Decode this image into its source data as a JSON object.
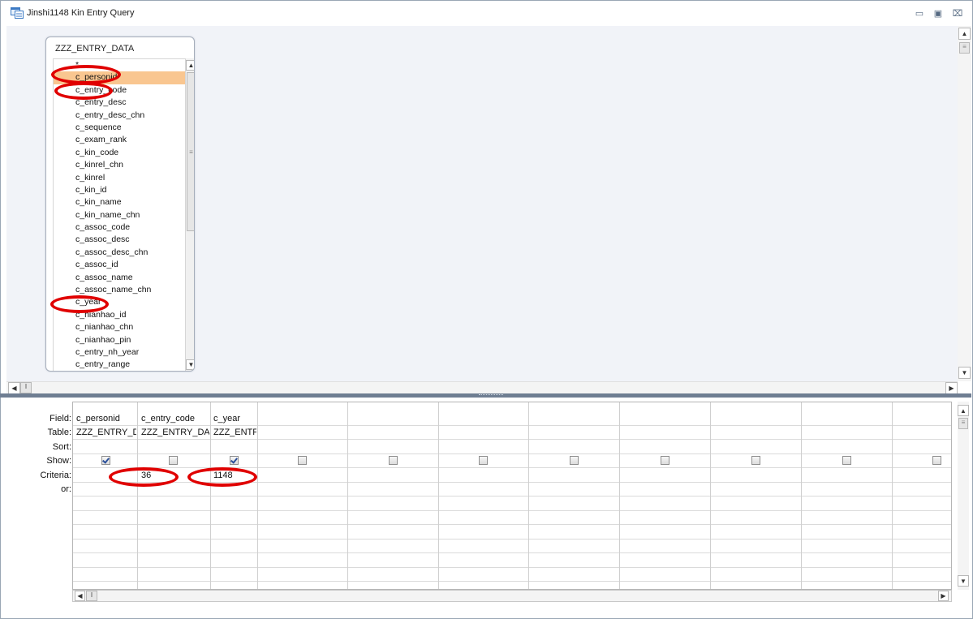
{
  "window": {
    "title": "Jinshi1148 Kin Entry Query",
    "minimize_icon": "minimize-icon",
    "restore_icon": "restore-icon",
    "close_icon": "close-icon"
  },
  "table_box": {
    "title": "ZZZ_ENTRY_DATA",
    "fields": [
      "*",
      "c_personid",
      "c_entry_code",
      "c_entry_desc",
      "c_entry_desc_chn",
      "c_sequence",
      "c_exam_rank",
      "c_kin_code",
      "c_kinrel_chn",
      "c_kinrel",
      "c_kin_id",
      "c_kin_name",
      "c_kin_name_chn",
      "c_assoc_code",
      "c_assoc_desc",
      "c_assoc_desc_chn",
      "c_assoc_id",
      "c_assoc_name",
      "c_assoc_name_chn",
      "c_year",
      "c_nianhao_id",
      "c_nianhao_chn",
      "c_nianhao_pin",
      "c_entry_nh_year",
      "c_entry_range"
    ],
    "selected_field": "c_personid"
  },
  "grid": {
    "row_labels": {
      "field": "Field:",
      "table": "Table:",
      "sort": "Sort:",
      "show": "Show:",
      "criteria": "Criteria:",
      "or": "or:"
    },
    "columns": [
      {
        "field": "c_personid",
        "table": "ZZZ_ENTRY_D",
        "show": true,
        "criteria": ""
      },
      {
        "field": "c_entry_code",
        "table": "ZZZ_ENTRY_DA",
        "show": false,
        "criteria": "36"
      },
      {
        "field": "c_year",
        "table": "ZZZ_ENTF",
        "show": true,
        "criteria": "1148"
      },
      {
        "field": "",
        "table": "",
        "show": false,
        "criteria": ""
      },
      {
        "field": "",
        "table": "",
        "show": false,
        "criteria": ""
      },
      {
        "field": "",
        "table": "",
        "show": false,
        "criteria": ""
      },
      {
        "field": "",
        "table": "",
        "show": false,
        "criteria": ""
      },
      {
        "field": "",
        "table": "",
        "show": false,
        "criteria": ""
      },
      {
        "field": "",
        "table": "",
        "show": false,
        "criteria": ""
      },
      {
        "field": "",
        "table": "",
        "show": false,
        "criteria": ""
      },
      {
        "field": "",
        "table": "",
        "show": false,
        "criteria": ""
      }
    ]
  },
  "colors": {
    "annotation_red": "#e00000",
    "selected_field_bg": "#f9c690",
    "splitter": "#6f7e92"
  }
}
